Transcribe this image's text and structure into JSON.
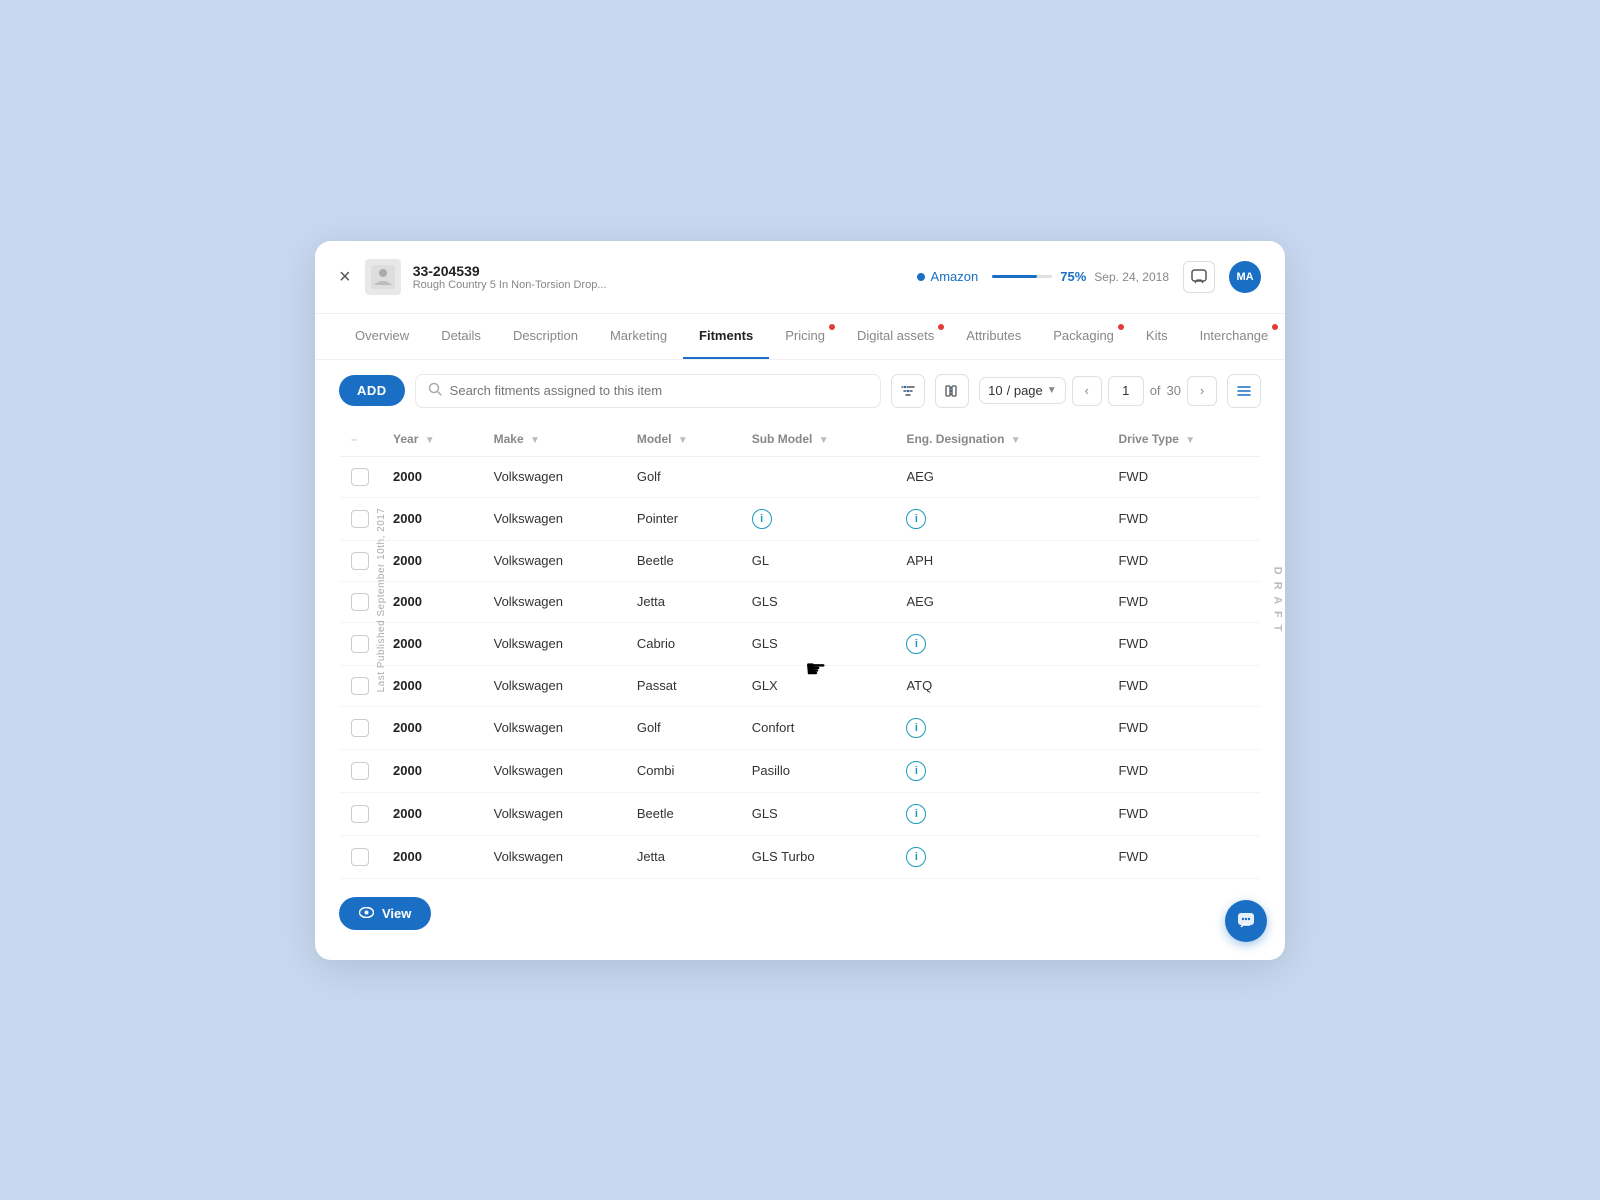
{
  "modal": {
    "close_label": "×",
    "product_id": "33-204539",
    "product_name": "Rough Country 5 In Non-Torsion Drop...",
    "channel": "Amazon",
    "progress_pct": "75%",
    "progress_date": "Sep. 24, 2018",
    "avatar": "MA"
  },
  "tabs": [
    {
      "label": "Overview",
      "active": false,
      "dot": false
    },
    {
      "label": "Details",
      "active": false,
      "dot": false
    },
    {
      "label": "Description",
      "active": false,
      "dot": false
    },
    {
      "label": "Marketing",
      "active": false,
      "dot": false
    },
    {
      "label": "Fitments",
      "active": true,
      "dot": false
    },
    {
      "label": "Pricing",
      "active": false,
      "dot": true
    },
    {
      "label": "Digital assets",
      "active": false,
      "dot": true
    },
    {
      "label": "Attributes",
      "active": false,
      "dot": false
    },
    {
      "label": "Packaging",
      "active": false,
      "dot": true
    },
    {
      "label": "Kits",
      "active": false,
      "dot": false
    },
    {
      "label": "Interchange",
      "active": false,
      "dot": true
    }
  ],
  "toolbar": {
    "add_label": "ADD",
    "search_placeholder": "Search fitments",
    "search_suffix": "assigned to this item",
    "per_page": "10",
    "per_page_suffix": "/ page",
    "current_page": "1",
    "total_pages": "30"
  },
  "table": {
    "columns": [
      {
        "label": "Year",
        "sortable": true
      },
      {
        "label": "Make",
        "sortable": true
      },
      {
        "label": "Model",
        "sortable": true
      },
      {
        "label": "Sub Model",
        "sortable": true
      },
      {
        "label": "Eng. Designation",
        "sortable": true
      },
      {
        "label": "Drive Type",
        "sortable": true
      }
    ],
    "rows": [
      {
        "year": "2000",
        "make": "Volkswagen",
        "model": "Golf",
        "sub_model": "",
        "sub_model_info": false,
        "eng_desig": "AEG",
        "eng_info": false,
        "drive": "FWD"
      },
      {
        "year": "2000",
        "make": "Volkswagen",
        "model": "Pointer",
        "sub_model": "",
        "sub_model_info": true,
        "eng_desig": "",
        "eng_info": true,
        "drive": "FWD"
      },
      {
        "year": "2000",
        "make": "Volkswagen",
        "model": "Beetle",
        "sub_model": "GL",
        "sub_model_info": false,
        "eng_desig": "APH",
        "eng_info": false,
        "drive": "FWD"
      },
      {
        "year": "2000",
        "make": "Volkswagen",
        "model": "Jetta",
        "sub_model": "GLS",
        "sub_model_info": false,
        "eng_desig": "AEG",
        "eng_info": false,
        "drive": "FWD"
      },
      {
        "year": "2000",
        "make": "Volkswagen",
        "model": "Cabrio",
        "sub_model": "GLS",
        "sub_model_info": false,
        "eng_desig": "",
        "eng_info": true,
        "drive": "FWD"
      },
      {
        "year": "2000",
        "make": "Volkswagen",
        "model": "Passat",
        "sub_model": "GLX",
        "sub_model_info": false,
        "eng_desig": "ATQ",
        "eng_info": false,
        "drive": "FWD"
      },
      {
        "year": "2000",
        "make": "Volkswagen",
        "model": "Golf",
        "sub_model": "Confort",
        "sub_model_info": false,
        "eng_desig": "",
        "eng_info": true,
        "drive": "FWD"
      },
      {
        "year": "2000",
        "make": "Volkswagen",
        "model": "Combi",
        "sub_model": "Pasillo",
        "sub_model_info": false,
        "eng_desig": "",
        "eng_info": true,
        "drive": "FWD"
      },
      {
        "year": "2000",
        "make": "Volkswagen",
        "model": "Beetle",
        "sub_model": "GLS",
        "sub_model_info": false,
        "eng_desig": "",
        "eng_info": true,
        "drive": "FWD"
      },
      {
        "year": "2000",
        "make": "Volkswagen",
        "model": "Jetta",
        "sub_model": "GLS Turbo",
        "sub_model_info": false,
        "eng_desig": "",
        "eng_info": true,
        "drive": "FWD"
      }
    ]
  },
  "footer": {
    "view_label": "View"
  },
  "side_labels": {
    "left": "Last Published September 10th, 2017",
    "right": "D R A F T"
  },
  "icons": {
    "info": "i",
    "chat": "💬",
    "eye": "👁"
  }
}
